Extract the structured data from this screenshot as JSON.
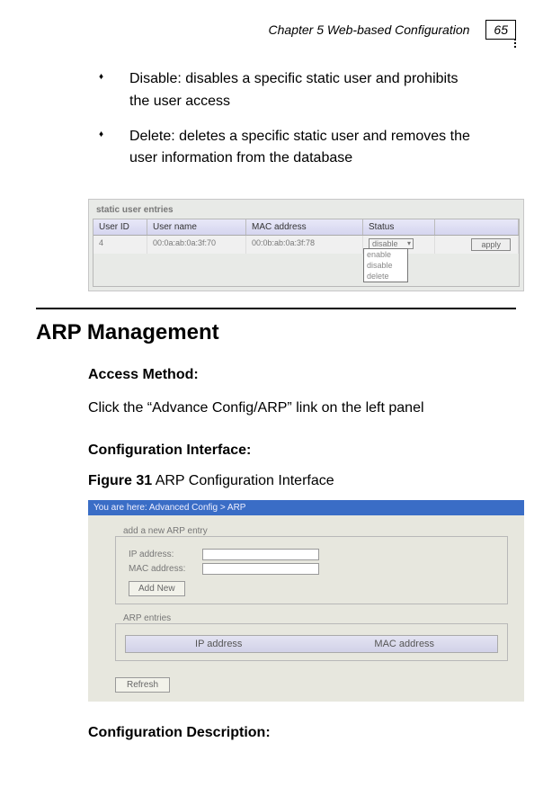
{
  "header": {
    "chapter": "Chapter 5 Web-based Configuration",
    "page": "65"
  },
  "bullets": [
    "Disable: disables a specific static user and prohibits the user access",
    "Delete: deletes a specific static user and removes the user information from the database"
  ],
  "fig1": {
    "caption": "static user entries",
    "cols": {
      "id": "User ID",
      "name": "User name",
      "mac": "MAC address",
      "status": "Status"
    },
    "row": {
      "id": "4",
      "name": "00:0a:ab:0a:3f:70",
      "mac": "00:0b:ab:0a:3f:78"
    },
    "select_value": "disable",
    "options": [
      "enable",
      "disable",
      "delete"
    ],
    "apply": "apply"
  },
  "section": {
    "title": "ARP Management",
    "access_h": "Access Method:",
    "access_p": "Click the “Advance Config/ARP” link on the left panel",
    "iface_h": "Configuration Interface:",
    "fig_label_b": "Figure 31",
    "fig_label": " ARP Configuration Interface",
    "desc_h": "Configuration Description:"
  },
  "fig2": {
    "bar": "You are here:  Advanced Config > ARP",
    "legend1": "add a new ARP entry",
    "ip_label": "IP address:",
    "mac_label": "MAC address:",
    "add": "Add New",
    "legend2": "ARP entries",
    "th_ip": "IP address",
    "th_mac": "MAC address",
    "refresh": "Refresh"
  }
}
